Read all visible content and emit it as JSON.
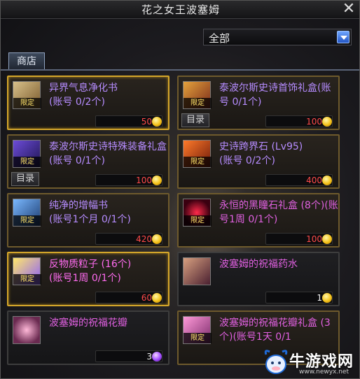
{
  "window": {
    "title": "花之女王波塞姆"
  },
  "filter": {
    "selected": "全部"
  },
  "tabs": [
    {
      "label": "商店"
    }
  ],
  "items": [
    {
      "name": "异界气息净化书\n(账号 0/2个)",
      "price": "50",
      "limited": "限定",
      "catalog": ""
    },
    {
      "name": "泰波尔斯史诗首饰礼盒(账号 0/1个)",
      "price": "100",
      "limited": "限定",
      "catalog": "目录"
    },
    {
      "name": "泰波尔斯史诗特殊装备礼盒(账号 0/1个)",
      "price": "100",
      "limited": "限定",
      "catalog": "目录"
    },
    {
      "name": "史诗跨界石 (Lv95)\n(账号 0/2个)",
      "price": "400",
      "limited": "限定",
      "catalog": ""
    },
    {
      "name": "纯净的增幅书\n(账号1个月 0/1个)",
      "price": "420",
      "limited": "限定",
      "catalog": ""
    },
    {
      "name": "永恒的黑瞳石礼盒 (8个)(账号1周 0/1个)",
      "price": "100",
      "limited": "限定",
      "catalog": ""
    },
    {
      "name": "反物质粒子 (16个)\n(账号1周 0/1个)",
      "price": "60",
      "limited": "限定",
      "catalog": ""
    },
    {
      "name": "波塞姆的祝福药水",
      "price": "1",
      "limited": "",
      "catalog": ""
    },
    {
      "name": "波塞姆的祝福花瓣",
      "price": "3",
      "limited": "",
      "catalog": ""
    },
    {
      "name": "波塞姆的祝福花瓣礼盒 (3个)(账号1天 0/1",
      "price": "",
      "limited": "限定",
      "catalog": ""
    }
  ],
  "watermark": {
    "text": "牛游戏网",
    "url": "www.newyx.net"
  },
  "colors": {
    "price_red": "#ff4a4a",
    "name_purple": "#b68cff",
    "name_pink": "#ff6bf0",
    "gold_border": "#d4a62a"
  },
  "icons": [
    "close-icon",
    "dropdown-arrow-icon",
    "coin-icon",
    "purple-coin-icon"
  ]
}
